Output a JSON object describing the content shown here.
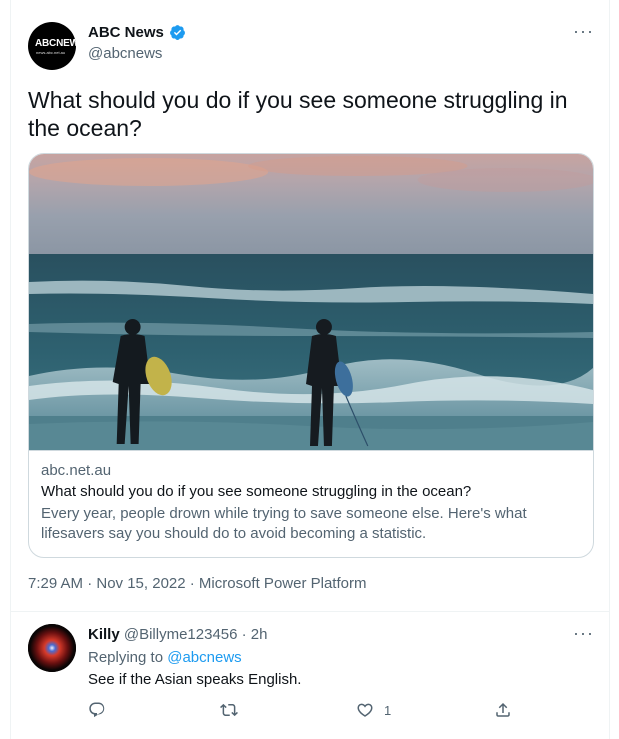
{
  "tweet": {
    "author": {
      "display_name": "ABC News",
      "handle": "@abcnews",
      "avatar_logo_text": "ABCNEWS",
      "avatar_logo_sub": "news.abc.net.au",
      "verified": true
    },
    "more_icon": "more-horizontal-icon",
    "text": "What should you do if you see someone struggling in the ocean?",
    "card": {
      "domain": "abc.net.au",
      "title": "What should you do if you see someone struggling in the ocean?",
      "description": "Every year, people drown while trying to save someone else. Here's what lifesavers say you should do to avoid becoming a statistic."
    },
    "meta": "7:29 AM · Nov 15, 2022 · Microsoft Power Platform"
  },
  "reply": {
    "display_name": "Killy",
    "handle_time": "@Billyme123456 · 2h",
    "replying_prefix": "Replying to",
    "replying_mention": "@abcnews",
    "text": "See if the Asian speaks English.",
    "actions": {
      "reply_icon": "reply-icon",
      "retweet_icon": "retweet-icon",
      "like_icon": "heart-icon",
      "like_count": "1",
      "share_icon": "share-icon"
    }
  },
  "colors": {
    "accent": "#1d9bf0",
    "text_primary": "#0f1419",
    "text_secondary": "#536471",
    "border": "#cfd9de"
  }
}
